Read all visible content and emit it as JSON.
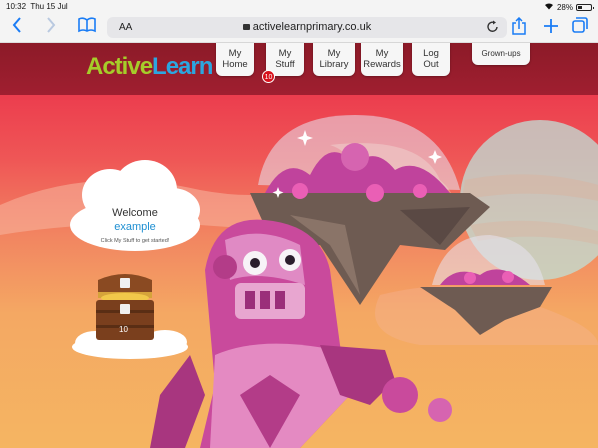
{
  "statusbar": {
    "time": "10:32",
    "date": "Thu 15 Jul",
    "battery": "28%"
  },
  "browser": {
    "text_size_label": "AA",
    "url": "activelearnprimary.co.uk",
    "icons": [
      "back-icon",
      "forward-icon",
      "bookmarks-icon",
      "reload-icon",
      "share-icon",
      "new-tab-icon",
      "tabs-icon"
    ]
  },
  "site": {
    "logo_part1": "Active",
    "logo_part2": "Learn",
    "nav": [
      {
        "line1": "My",
        "line2": "Home"
      },
      {
        "line1": "My",
        "line2": "Stuff"
      },
      {
        "line1": "My",
        "line2": "Library"
      },
      {
        "line1": "My",
        "line2": "Rewards"
      },
      {
        "line1": "Log",
        "line2": "Out"
      }
    ],
    "stuff_badge": "10",
    "grownups": "Grown-ups"
  },
  "welcome": {
    "title": "Welcome",
    "username": "example",
    "hint": "Click My Stuff to get started!",
    "chest_count": "10"
  },
  "colors": {
    "nav_bar": "#a01f30",
    "accent_blue": "#1a7cf5",
    "badge": "#d8111c",
    "sky_top": "#ec3d4e",
    "sky_bottom": "#f5b562"
  }
}
